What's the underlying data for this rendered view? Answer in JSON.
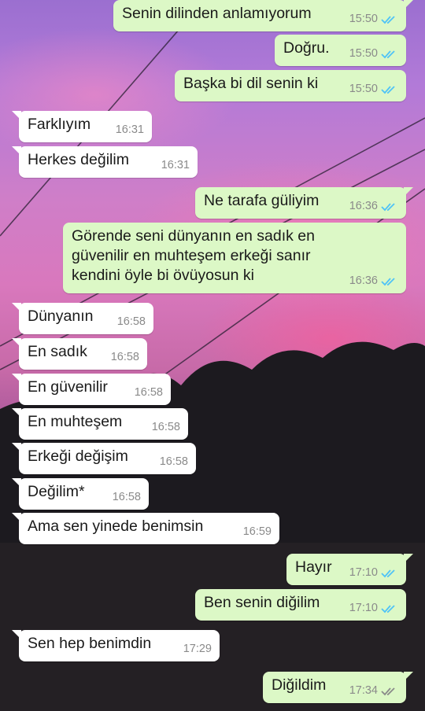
{
  "colors": {
    "incoming_bubble": "#ffffff",
    "outgoing_bubble": "#dcf8c6",
    "tick_read": "#4fc3f7",
    "tick_sent": "#8a8a8a",
    "timestamp": "#8a8a8a"
  },
  "messages": [
    {
      "direction": "out",
      "text": "Senin dilinden anlamıyorum",
      "time": "15:50",
      "status": "read"
    },
    {
      "direction": "out",
      "text": "Doğru.",
      "time": "15:50",
      "status": "read"
    },
    {
      "direction": "out",
      "text": "Başka bi dil senin ki",
      "time": "15:50",
      "status": "read"
    },
    {
      "direction": "in",
      "text": "Farklıyım",
      "time": "16:31"
    },
    {
      "direction": "in",
      "text": "Herkes değilim",
      "time": "16:31"
    },
    {
      "direction": "out",
      "text": "Ne tarafa güliyim",
      "time": "16:36",
      "status": "read"
    },
    {
      "direction": "out",
      "text": "Görende seni dünyanın en sadık en\ngüvenilir en muhteşem erkeği sanır\nkendini öyle bi övüyosun ki",
      "time": "16:36",
      "status": "read"
    },
    {
      "direction": "in",
      "text": "Dünyanın",
      "time": "16:58"
    },
    {
      "direction": "in",
      "text": "En sadık",
      "time": "16:58"
    },
    {
      "direction": "in",
      "text": "En güvenilir",
      "time": "16:58"
    },
    {
      "direction": "in",
      "text": "En muhteşem",
      "time": "16:58"
    },
    {
      "direction": "in",
      "text": "Erkeği değişim",
      "time": "16:58"
    },
    {
      "direction": "in",
      "text": "Değilim*",
      "time": "16:58"
    },
    {
      "direction": "in",
      "text": "Ama sen yinede benimsin",
      "time": "16:59"
    },
    {
      "direction": "out",
      "text": "Hayır",
      "time": "17:10",
      "status": "read"
    },
    {
      "direction": "out",
      "text": "Ben senin diğilim",
      "time": "17:10",
      "status": "read"
    },
    {
      "direction": "in",
      "text": "Sen hep benimdin",
      "time": "17:29"
    },
    {
      "direction": "out",
      "text": "Diğildim",
      "time": "17:34",
      "status": "delivered"
    }
  ]
}
